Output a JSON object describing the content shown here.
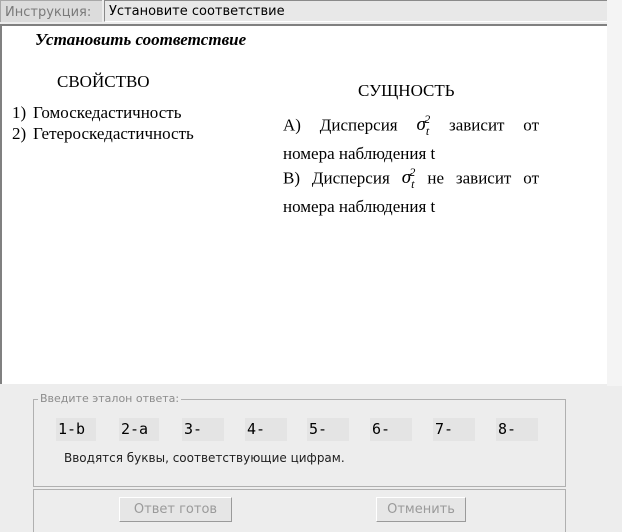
{
  "instruction": {
    "label": "Инструкция:",
    "text": "Установите соответствие"
  },
  "task": {
    "title": "Установить соответствие",
    "left_heading": "СВОЙСТВО",
    "right_heading": "СУЩНОСТЬ",
    "properties": [
      {
        "num": "1)",
        "text": "Гомоскедастичность"
      },
      {
        "num": "2)",
        "text": "Гетероскедастичность"
      }
    ],
    "essences": [
      {
        "prefix": "А)",
        "before": "Дисперсия",
        "symbol": "σ",
        "sub": "t",
        "sup": "2",
        "after": "зависит от",
        "line2": "номера наблюдения t"
      },
      {
        "prefix": "В)",
        "before": "Дисперсия",
        "symbol": "σ",
        "sub": "t",
        "sup": "2",
        "after": "не зависит от",
        "line2": "номера наблюдения t"
      }
    ]
  },
  "answer": {
    "legend": "Введите эталон ответа:",
    "slots": [
      "1-b",
      "2-a",
      "3-",
      "4-",
      "5-",
      "6-",
      "7-",
      "8-"
    ],
    "hint": "Вводятся буквы, соответствующие цифрам."
  },
  "buttons": {
    "ready": "Ответ готов",
    "cancel": "Отменить"
  }
}
